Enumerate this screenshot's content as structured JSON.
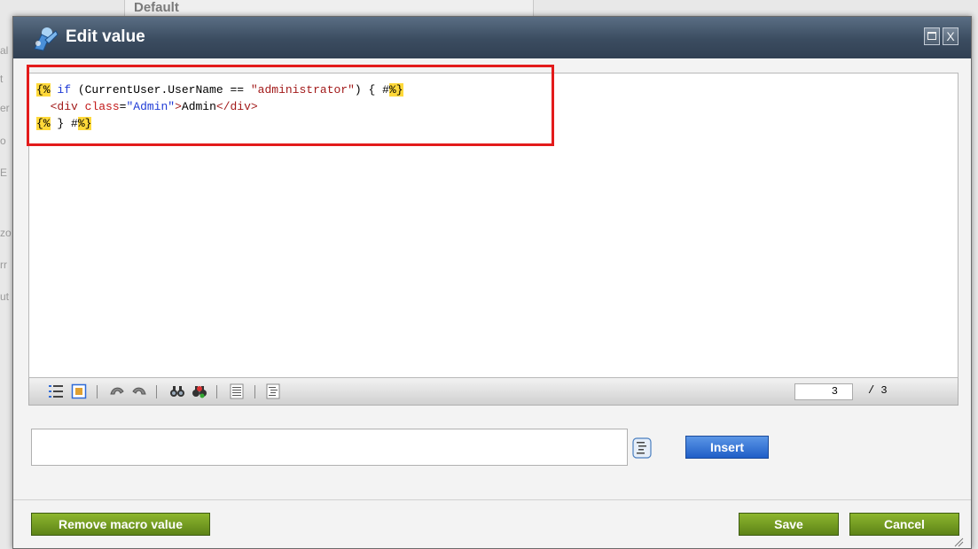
{
  "background": {
    "tab_label": "Default",
    "left_fragments": [
      "al",
      "t",
      "er",
      "o",
      "E",
      "zo",
      "rr",
      "ut"
    ]
  },
  "dialog": {
    "title": "Edit value",
    "title_icon": "macro-wizard-icon",
    "maximize_icon": "maximize-icon",
    "close_label": "X"
  },
  "editor": {
    "code": {
      "line1": {
        "open": "{%",
        "kw": "if",
        "mid": " (CurrentUser.UserName == ",
        "str": "\"administrator\"",
        "tail": ") { #",
        "close": "%}"
      },
      "line2": {
        "indent": "  ",
        "tag_open": "<div",
        "attr": "class",
        "eq": "=",
        "aval": "\"Admin\"",
        "gt": ">",
        "text": "Admin",
        "tag_close": "</div>"
      },
      "line3": {
        "open": "{%",
        "mid": " } #",
        "close": "%}"
      }
    }
  },
  "toolbar": {
    "icons": [
      "line-numbers-icon",
      "fullscreen-icon",
      "undo-icon",
      "redo-icon",
      "find-icon",
      "replace-icon",
      "format-icon",
      "indent-icon"
    ],
    "current_line": "3",
    "total_lines": "/ 3"
  },
  "macro": {
    "input_value": "",
    "icon": "macro-tree-icon",
    "insert_label": "Insert"
  },
  "footer": {
    "remove_label": "Remove macro value",
    "save_label": "Save",
    "cancel_label": "Cancel"
  },
  "colors": {
    "title_bar": "#3b4c60",
    "highlight_box": "#e31b1b",
    "macro_marker": "#ffd93a",
    "insert_button": "#1f5ec7",
    "green_button": "#5d8317"
  }
}
